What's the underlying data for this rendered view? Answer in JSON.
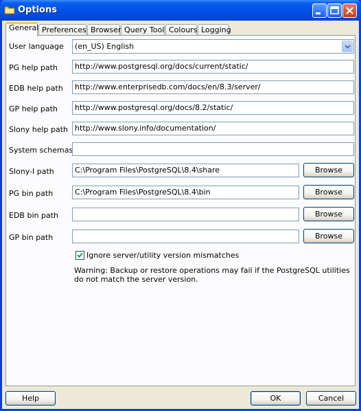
{
  "window": {
    "title": "Options"
  },
  "tabs": [
    "General",
    "Preferences",
    "Browser",
    "Query Tool",
    "Colours",
    "Logging"
  ],
  "general": {
    "user_language_label": "User language",
    "user_language_value": "(en_US) English",
    "pg_help_label": "PG help path",
    "pg_help_value": "http://www.postgresql.org/docs/current/static/",
    "edb_help_label": "EDB help path",
    "edb_help_value": "http://www.enterprisedb.com/docs/en/8.3/server/",
    "gp_help_label": "GP help path",
    "gp_help_value": "http://www.postgresql.org/docs/8.2/static/",
    "slony_help_label": "Slony help path",
    "slony_help_value": "http://www.slony.info/documentation/",
    "system_schemas_label": "System schemas",
    "system_schemas_value": "",
    "slony_path_label": "Slony-I path",
    "slony_path_value": "C:\\Program Files\\PostgreSQL\\8.4\\share",
    "pg_bin_label": "PG bin path",
    "pg_bin_value": "C:\\Program Files\\PostgreSQL\\8.4\\bin",
    "edb_bin_label": "EDB bin path",
    "edb_bin_value": "",
    "gp_bin_label": "GP bin path",
    "gp_bin_value": "",
    "browse_label": "Browse",
    "ignore_mismatch_label": "Ignore server/utility version mismatches",
    "ignore_mismatch_checked": true,
    "warning_text": "Warning: Backup or restore operations may fail if the PostgreSQL utilities do not match the server version."
  },
  "footer": {
    "help_label": "Help",
    "ok_label": "OK",
    "cancel_label": "Cancel"
  },
  "colors": {
    "titlebar": "#0052e6",
    "dialog_bg": "#ece9d8",
    "tab_highlight": "#ffc83c"
  }
}
